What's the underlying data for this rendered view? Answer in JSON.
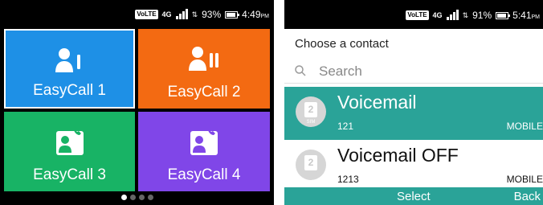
{
  "left_phone": {
    "status": {
      "volte": "VoLTE",
      "network": "4G",
      "battery": "93%",
      "time": "4:49",
      "ampm": "PM"
    },
    "tiles": [
      {
        "label": "EasyCall 1",
        "color": "#1e90e6"
      },
      {
        "label": "EasyCall 2",
        "color": "#f36a12"
      },
      {
        "label": "EasyCall 3",
        "color": "#18b365"
      },
      {
        "label": "EasyCall 4",
        "color": "#8046e8"
      }
    ],
    "pager": {
      "pages": 4,
      "active": 1
    }
  },
  "right_phone": {
    "status": {
      "volte": "VoLTE",
      "network": "4G",
      "battery": "91%",
      "time": "5:41",
      "ampm": "PM"
    },
    "title": "Choose a contact",
    "search": {
      "placeholder": "Search",
      "icon": "search-icon"
    },
    "contacts": [
      {
        "name": "Voicemail",
        "number": "121",
        "type": "MOBILE",
        "sim_label": "2",
        "sim_caption": "SIM",
        "selected": true
      },
      {
        "name": "Voicemail OFF",
        "number": "1213",
        "type": "MOBILE",
        "sim_label": "2",
        "selected": false
      }
    ],
    "softkeys": {
      "center": "Select",
      "right": "Back"
    },
    "accent": "#2aa398"
  }
}
